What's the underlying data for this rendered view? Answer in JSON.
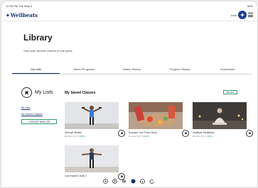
{
  "status": {
    "time": "12:39 PM  Tue May 9",
    "battery": "68%"
  },
  "header": {
    "logo_text": "Wellbeats",
    "profile_name": "Joan"
  },
  "page": {
    "title": "Library",
    "subtitle": "View your favorite content in one place."
  },
  "tabs": [
    {
      "label": "My Lists"
    },
    {
      "label": "Saved Programs"
    },
    {
      "label": "Watch History"
    },
    {
      "label": "Program History"
    },
    {
      "label": "Downloads"
    }
  ],
  "sidebar": {
    "title": "My Lists",
    "links": [
      "All Lists",
      "My Saved Classes"
    ],
    "create_button": "+ CREATE NEW LIST"
  },
  "main": {
    "title": "My Saved Classes",
    "select_button": "SELECT",
    "cards": [
      {
        "title": "Strength Builder",
        "meta_time": "28 mins",
        "meta_rating": "4.7 (3800)"
      },
      {
        "title": "Energize Your Entire Body",
        "meta_time": "11 mins",
        "meta_rating": "4.7 (1400)"
      },
      {
        "title": "Gratitude Meditation",
        "meta_time": "28 mins",
        "meta_rating": "4.7 (3801)"
      },
      {
        "title": "Low Impact Cardio 2",
        "meta_time": "",
        "meta_rating": ""
      }
    ]
  },
  "colors": {
    "brand": "#15306e",
    "accent": "#2c9a6a"
  }
}
